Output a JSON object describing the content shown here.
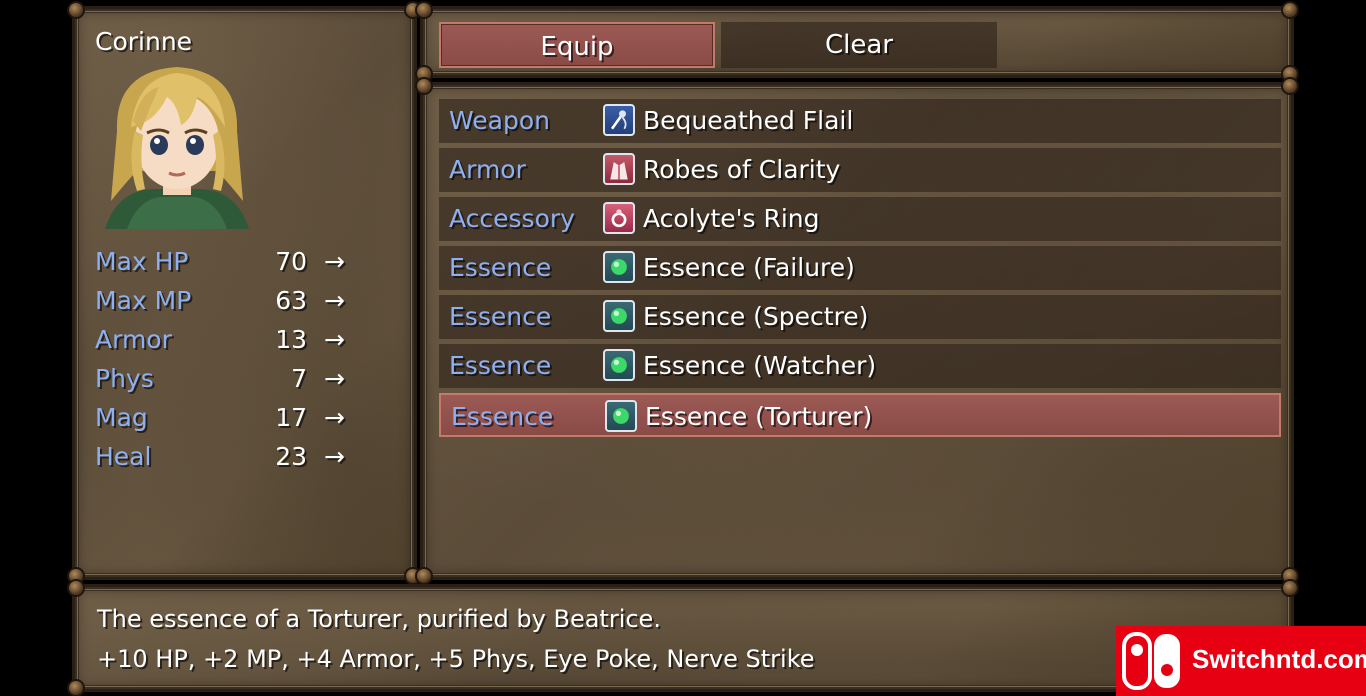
{
  "status": {
    "name": "Corinne",
    "stats": [
      {
        "name": "Max HP",
        "value": "70",
        "arrow": "→"
      },
      {
        "name": "Max MP",
        "value": "63",
        "arrow": "→"
      },
      {
        "name": "Armor",
        "value": "13",
        "arrow": "→"
      },
      {
        "name": "Phys",
        "value": "7",
        "arrow": "→"
      },
      {
        "name": "Mag",
        "value": "17",
        "arrow": "→"
      },
      {
        "name": "Heal",
        "value": "23",
        "arrow": "→"
      }
    ]
  },
  "commands": {
    "equip": "Equip",
    "clear": "Clear"
  },
  "slots": [
    {
      "type": "Weapon",
      "item": "Bequeathed Flail",
      "icon": "flail-icon"
    },
    {
      "type": "Armor",
      "item": "Robes of Clarity",
      "icon": "robe-icon"
    },
    {
      "type": "Accessory",
      "item": "Acolyte's Ring",
      "icon": "ring-icon"
    },
    {
      "type": "Essence",
      "item": "Essence (Failure)",
      "icon": "green-orb-icon"
    },
    {
      "type": "Essence",
      "item": "Essence (Spectre)",
      "icon": "green-orb-icon"
    },
    {
      "type": "Essence",
      "item": "Essence (Watcher)",
      "icon": "green-orb-icon"
    },
    {
      "type": "Essence",
      "item": "Essence (Torturer)",
      "icon": "green-orb-icon"
    }
  ],
  "selected_slot_index": 6,
  "help": {
    "line1": "The essence of a Torturer, purified by Beatrice.",
    "line2": "+10 HP, +2 MP, +4 Armor, +5 Phys, Eye Poke, Nerve Strike"
  },
  "watermark": {
    "text": "Switchntd.com"
  },
  "colors": {
    "label": "#8fb0f0",
    "text": "#ffffff",
    "selection": "#9c5a55",
    "watermark": "#e60012"
  }
}
